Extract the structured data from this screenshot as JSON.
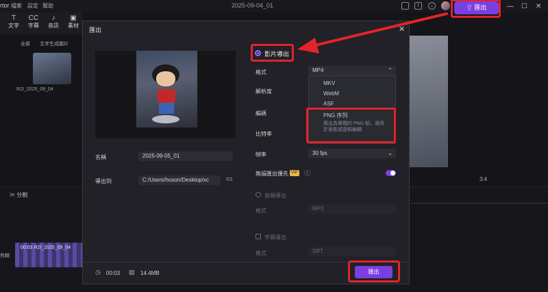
{
  "app": {
    "name": "rtor",
    "menus": [
      "檔案",
      "設定",
      "幫助"
    ],
    "project_title": "2025-09-04_01",
    "export_button": "匯出"
  },
  "tools": [
    {
      "label": "文字",
      "glyph": "T"
    },
    {
      "label": "字幕",
      "glyph": "CC"
    },
    {
      "label": "音訊",
      "glyph": "♪"
    },
    {
      "label": "素材",
      "glyph": "▣"
    }
  ],
  "library": {
    "tabs": [
      "全部",
      "文字生成圖片"
    ],
    "item_label": "R2I_2025_09_04"
  },
  "preview": {
    "zoom": "3:4"
  },
  "timeline": {
    "split_label": "分割",
    "clip_label": "00:03 R2I_2025_09_04",
    "track_label": "剪輯"
  },
  "dialog": {
    "title": "匯出",
    "name_label": "名稱",
    "name_value": "2025-09-05_01",
    "export_to_label": "導出到",
    "export_path": "C:/Users/hoson/Desktop/xc",
    "video_export_label": "影片導出",
    "format_label": "格式",
    "format_value": "MP4",
    "resolution_label": "解析度",
    "encoding_label": "編碼",
    "bitrate_label": "比特率",
    "framerate_label": "幀率",
    "framerate_value": "30  fps",
    "lossless_label": "無損匯出優先",
    "vip_badge": "VIP",
    "lossless_enabled": true,
    "dropdown_options": [
      "MKV",
      "WebM",
      "ASF",
      "PNG 序列"
    ],
    "png_hint": "匯出為單獨的 PNG 幀，適用於後製或逐幀編輯",
    "audio_export_label": "音頻導出",
    "audio_format_label": "格式",
    "audio_format_value": "MP3",
    "subtitle_export_label": "字幕導出",
    "subtitle_format_label": "格式",
    "subtitle_format_value": "SRT",
    "duration": "00:03",
    "file_size": "14.4MB",
    "export_button": "匯出"
  },
  "annotations": {
    "highlight_color": "#e2242a"
  },
  "colors": {
    "accent": "#7a3fe0",
    "background": "#141419",
    "dialog": "#212127"
  }
}
